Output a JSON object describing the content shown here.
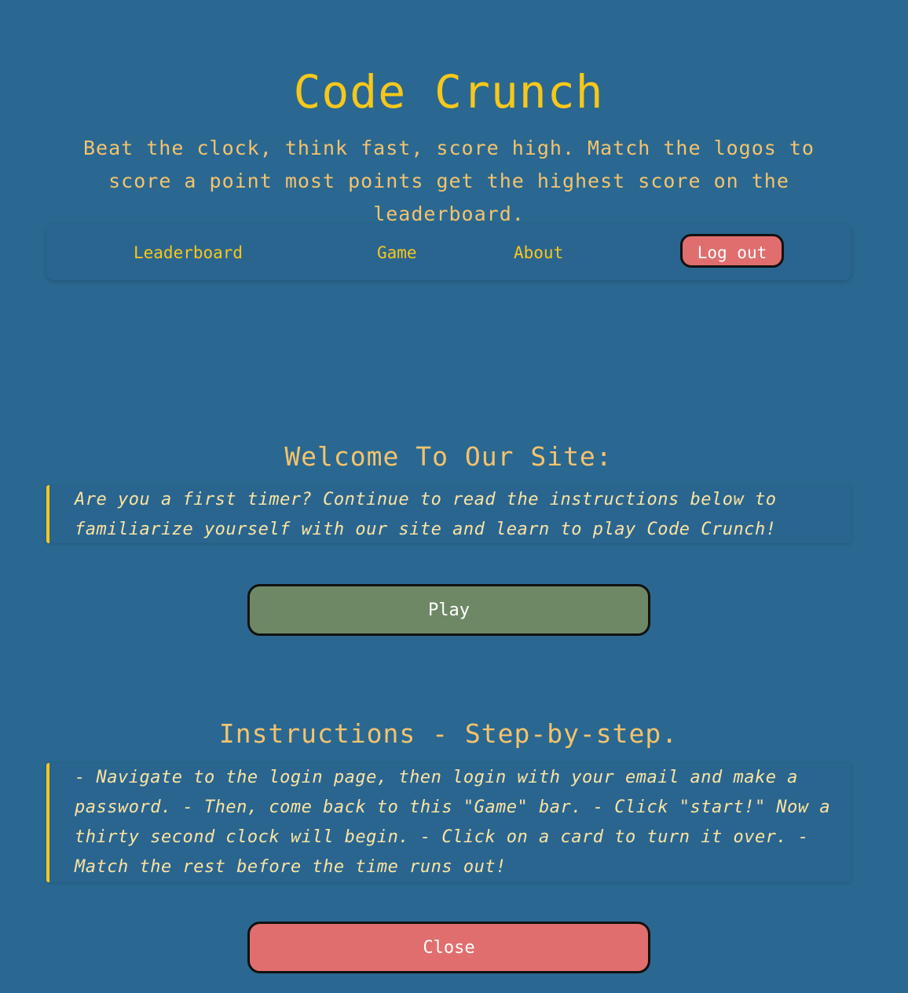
{
  "header": {
    "title": "Code Crunch",
    "tagline": "Beat the clock, think fast, score high. Match the logos to score a point most points get the highest score on the leaderboard."
  },
  "nav": {
    "items": [
      {
        "label": "Leaderboard"
      },
      {
        "label": "Game"
      },
      {
        "label": "About"
      }
    ],
    "logout_label": "Log out"
  },
  "welcome": {
    "heading": "Welcome To Our Site:",
    "text": "Are you a first timer? Continue to read the instructions below to familiarize yourself with our site and learn to play Code Crunch!",
    "play_label": "Play"
  },
  "instructions": {
    "heading": "Instructions - Step-by-step.",
    "text": "- Navigate to the login page, then login with your email and make a password. - Then, come back to this \"Game\" bar. - Click \"start!\" Now a thirty second clock will begin. - Click on a card to turn it over. - Match the rest before the time runs out!",
    "close_label": "Close"
  },
  "colors": {
    "background": "#2a6891",
    "title": "#f7c71a",
    "accent_text": "#f4c36d",
    "quote_text": "#fbe4a0",
    "play_button": "#6e8866",
    "close_button": "#e06e6e",
    "logout_button": "#e06e6e"
  }
}
